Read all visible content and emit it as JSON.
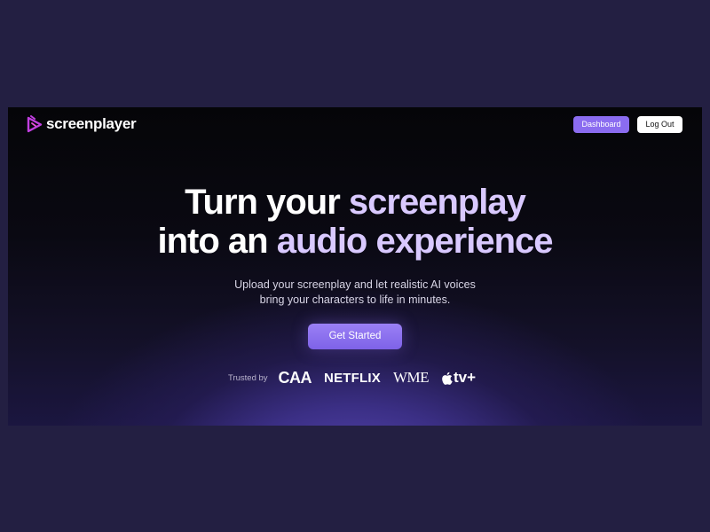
{
  "brand": {
    "name": "screenplayer",
    "logo_icon": "play-script-logo-icon",
    "accent_color": "#c13fe0"
  },
  "nav": {
    "dashboard_label": "Dashboard",
    "logout_label": "Log Out"
  },
  "hero": {
    "title_line1_plain": "Turn your ",
    "title_line1_accent": "screenplay",
    "title_line2_plain": "into an ",
    "title_line2_accent": "audio experience",
    "subtitle_line1": "Upload your screenplay and let realistic AI voices",
    "subtitle_line2": "bring your characters to life in minutes.",
    "cta_label": "Get Started"
  },
  "trusted": {
    "label": "Trusted by",
    "logos": {
      "caa": "CAA",
      "netflix": "NETFLIX",
      "wme": "WME",
      "appletv_text": "tv+"
    }
  },
  "colors": {
    "primary_button": "#8b6cf0",
    "title_accent": "#d9c9ff",
    "page_background": "#231f42"
  }
}
